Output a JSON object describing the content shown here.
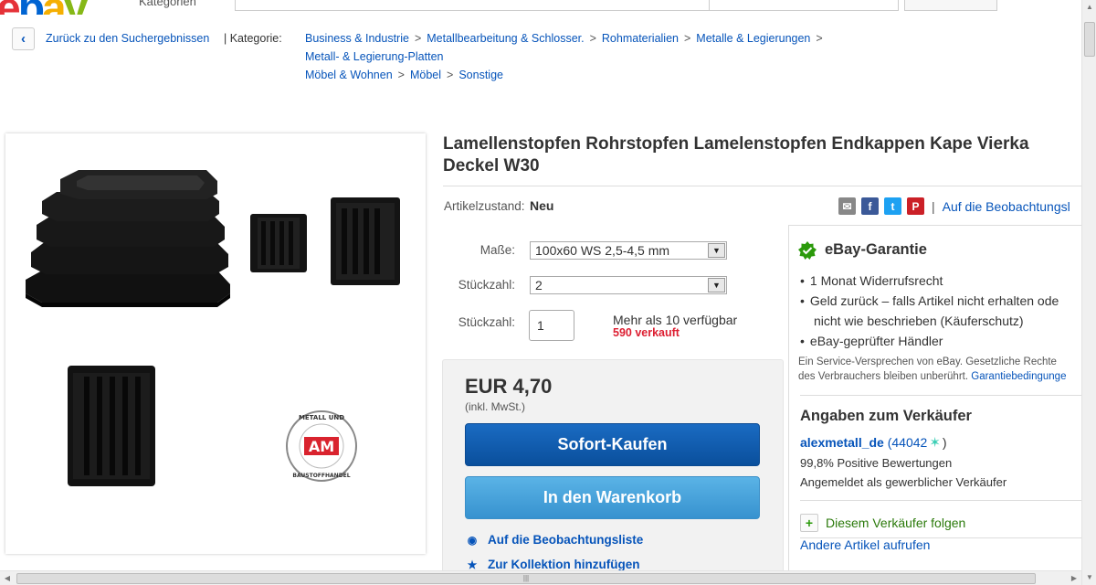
{
  "header": {
    "logo_letters": [
      "e",
      "b",
      "a",
      "y"
    ],
    "categories_label": "Kategorien"
  },
  "breadcrumb": {
    "back_label": "Zurück zu den Suchergebnissen",
    "category_label": "| Kategorie:",
    "paths": [
      [
        "Business & Industrie",
        "Metallbearbeitung & Schlosser.",
        "Rohmaterialien",
        "Metalle & Legierungen"
      ],
      [
        "Metall- & Legierung-Platten"
      ],
      [
        "Möbel & Wohnen",
        "Möbel",
        "Sonstige"
      ]
    ],
    "separator": ">"
  },
  "product": {
    "title_line1": "Lamellenstopfen Rohrstopfen Lamelenstopfen Endkappen Kape Vierka",
    "title_line2": "Deckel W30",
    "condition_label": "Artikelzustand:",
    "condition_value": "Neu",
    "size_label": "Maße:",
    "size_value": "100x60 WS 2,5-4,5 mm",
    "count_label": "Stückzahl:",
    "count_value": "2",
    "qty_label": "Stückzahl:",
    "qty_value": "1",
    "availability": "Mehr als 10 verfügbar",
    "sold": "590 verkauft",
    "logo_text_top": "METALL UND",
    "logo_text_mid": "AM",
    "logo_text_bottom": "BAUSTOFFHANDEL"
  },
  "purchase": {
    "price": "EUR 4,70",
    "vat_note": "(inkl. MwSt.)",
    "buy_now": "Sofort-Kaufen",
    "add_to_cart": "In den Warenkorb",
    "watchlist": "Auf die Beobachtungsliste",
    "collection": "Zur Kollektion hinzufügen"
  },
  "share": {
    "watch_top": "Auf die Beobachtungsl",
    "facebook": "f",
    "twitter": "t",
    "pinterest": "P",
    "separator": "|"
  },
  "guarantee": {
    "title": "eBay-Garantie",
    "items": [
      "1 Monat Widerrufsrecht",
      "Geld zurück – falls Artikel nicht erhalten ode",
      "nicht wie beschrieben (Käuferschutz)",
      "eBay-geprüfter Händler"
    ],
    "note_line1": "Ein Service-Versprechen von eBay. Gesetzliche Rechte",
    "note_line2": "des Verbrauchers bleiben unberührt.",
    "note_link": "Garantiebedingunge"
  },
  "seller": {
    "title": "Angaben zum Verkäufer",
    "name": "alexmetall_de",
    "score": "(44042",
    "score_close": ")",
    "positive": "99,8% Positive Bewertungen",
    "type": "Angemeldet als gewerblicher Verkäufer",
    "follow": "Diesem Verkäufer folgen",
    "other_items": "Andere Artikel aufrufen"
  },
  "colors": {
    "link": "#0654ba",
    "buy_button": "#0a4f9c",
    "cart_button": "#3792cf",
    "sold_red": "#dd1e31",
    "guarantee_green": "#2b9a0b"
  }
}
